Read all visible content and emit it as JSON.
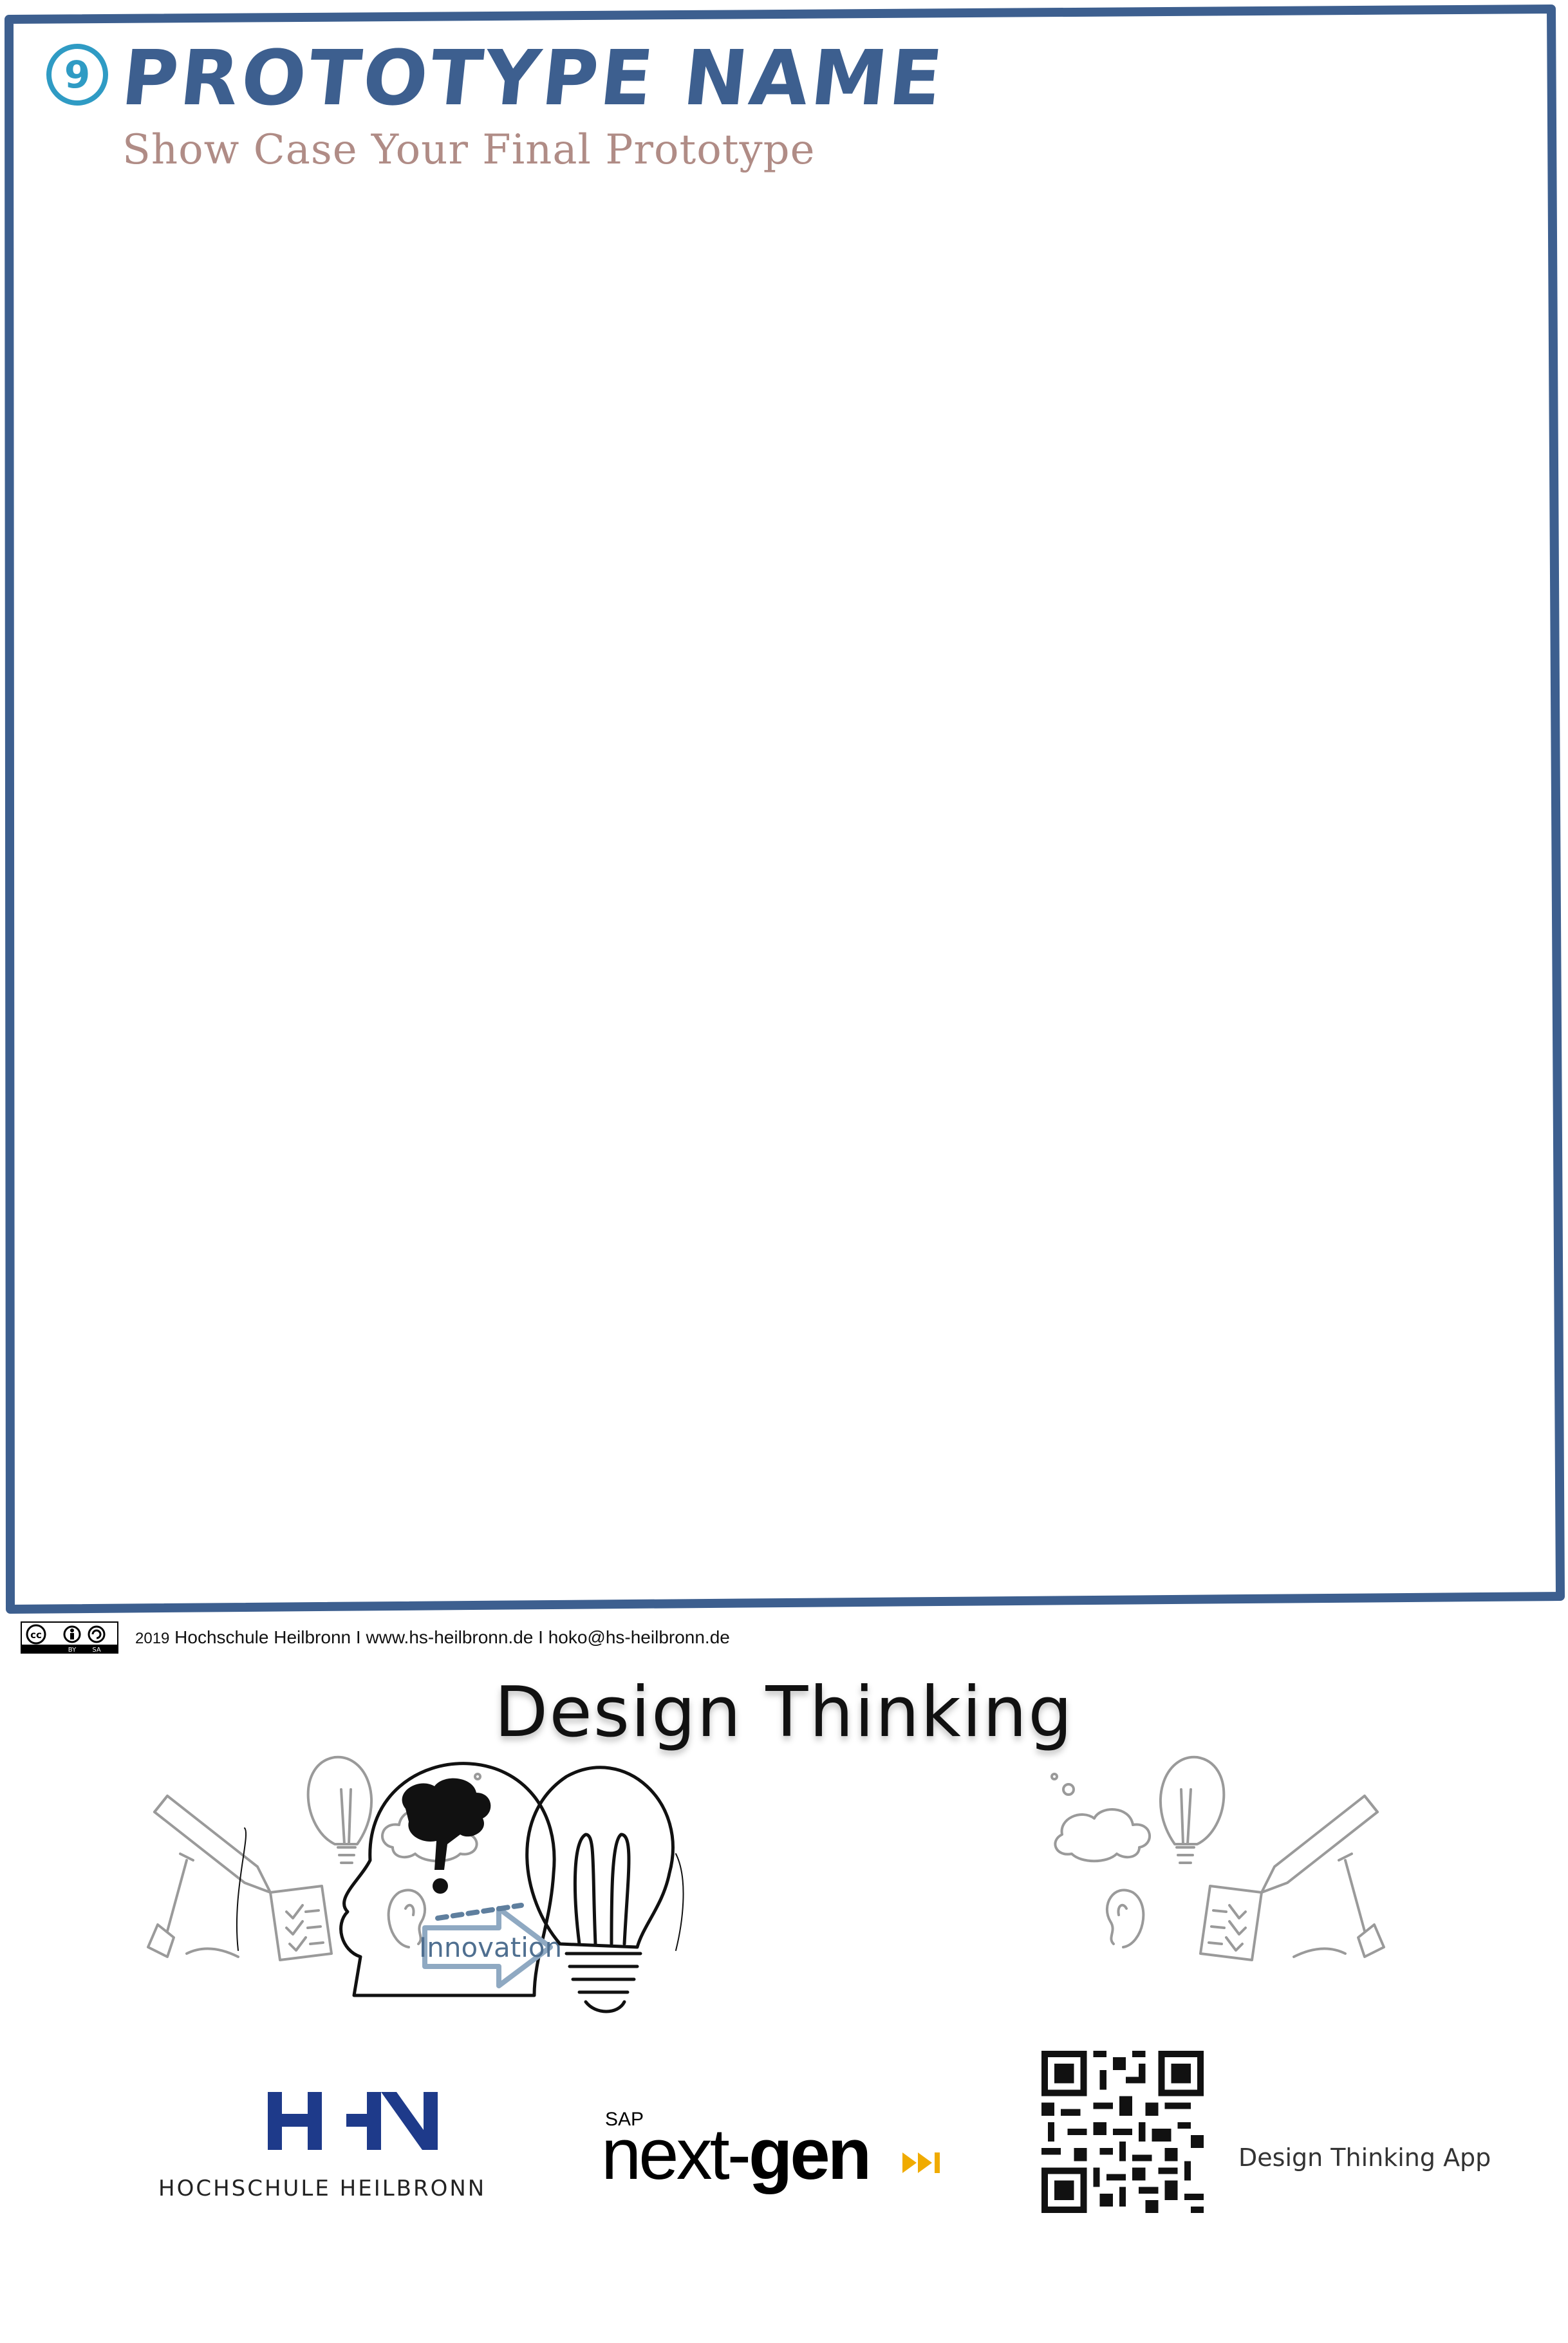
{
  "header": {
    "step_number": "9",
    "title": "PROTOTYPE NAME",
    "subtitle": "Show Case Your Final Prototype"
  },
  "footer": {
    "license_icon": "cc-by-sa-icon",
    "year": "2019",
    "text": "Hochschule Heilbronn I  www.hs-heilbronn.de I hoko@hs-heilbronn.de"
  },
  "banner": {
    "heading": "Design Thinking",
    "arrow_label": "Innovation",
    "icons": [
      "pencil-icon",
      "lightbulb-icon",
      "cloud-icon",
      "ear-icon",
      "checklist-icon",
      "shovel-icon",
      "head-with-brain-icon",
      "arrow-icon"
    ]
  },
  "logos": {
    "hhn_caption": "HOCHSCHULE HEILBRONN",
    "sap_prefix": "SAP",
    "sap_next": "next-",
    "sap_gen": "gen",
    "app_label": "Design Thinking App"
  },
  "colors": {
    "frame": "#3d5f8f",
    "title": "#3d5f8f",
    "subtitle": "#b08c86",
    "badge": "#2f9bc4",
    "hhn_blue": "#1e3a8a",
    "sap_orange": "#f0ab00",
    "innovation_arrow": "#8fa9c2"
  }
}
